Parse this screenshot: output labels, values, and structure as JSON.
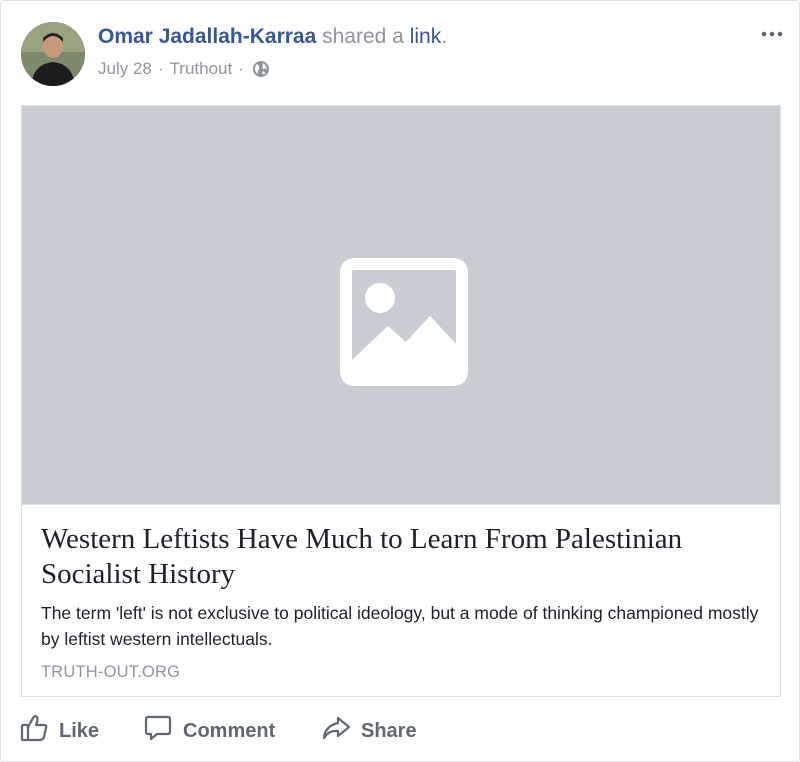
{
  "post": {
    "author": "Omar Jadallah-Karraa",
    "action_text": "shared a",
    "action_link": "link",
    "action_end": ".",
    "date": "July 28",
    "source": "Truthout",
    "dot": "·"
  },
  "link_preview": {
    "headline": "Western Leftists Have Much to Learn From Palestinian Socialist History",
    "description": "The term 'left' is not exclusive to political ideology, but a mode of thinking championed mostly by leftist western intellectuals.",
    "domain": "TRUTH-OUT.ORG",
    "image_placeholder_color": "#c9ccd3"
  },
  "actions": {
    "like": "Like",
    "comment": "Comment",
    "share": "Share"
  },
  "icons": {
    "privacy": "globe-icon",
    "more": "more-options-icon",
    "like": "thumbs-up-icon",
    "comment": "comment-bubble-icon",
    "share": "share-arrow-icon"
  },
  "colors": {
    "link_blue": "#365899",
    "meta_gray": "#90949c",
    "action_gray": "#606770",
    "text": "#1d2129"
  }
}
